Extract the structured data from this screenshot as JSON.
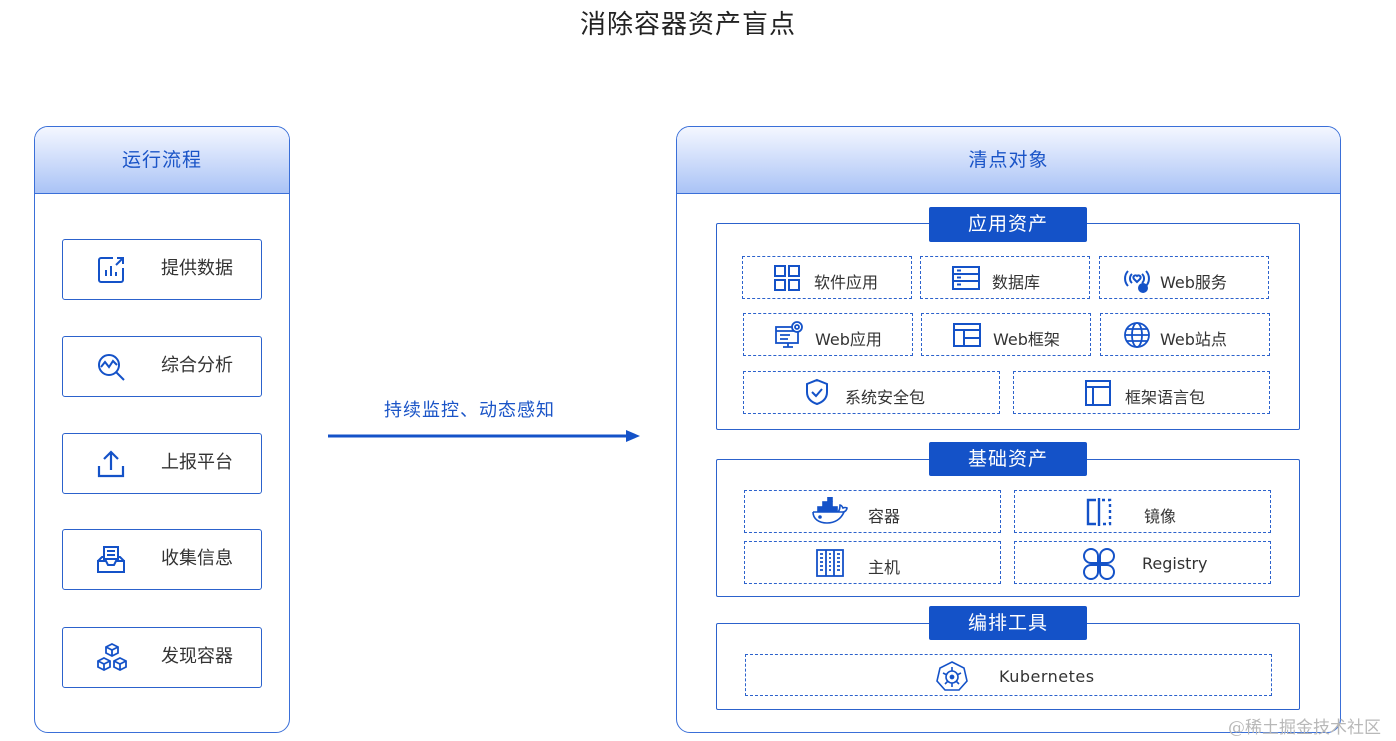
{
  "title": "消除容器资产盲点",
  "left_panel": {
    "header": "运行流程",
    "steps": [
      {
        "label": "提供数据",
        "icon": "bar-chart-icon"
      },
      {
        "label": "综合分析",
        "icon": "analysis-magnifier-icon"
      },
      {
        "label": "上报平台",
        "icon": "upload-icon"
      },
      {
        "label": "收集信息",
        "icon": "inbox-icon"
      },
      {
        "label": "发现容器",
        "icon": "cubes-icon"
      }
    ]
  },
  "arrow": {
    "label": "持续监控、动态感知"
  },
  "right_panel": {
    "header": "清点对象",
    "groups": [
      {
        "title": "应用资产",
        "items": [
          {
            "label": "软件应用",
            "icon": "grid-apps-icon"
          },
          {
            "label": "数据库",
            "icon": "database-icon"
          },
          {
            "label": "Web服务",
            "icon": "web-service-icon"
          },
          {
            "label": "Web应用",
            "icon": "web-app-icon"
          },
          {
            "label": "Web框架",
            "icon": "web-frame-icon"
          },
          {
            "label": "Web站点",
            "icon": "globe-icon"
          },
          {
            "label": "系统安全包",
            "icon": "shield-check-icon"
          },
          {
            "label": "框架语言包",
            "icon": "layout-icon"
          }
        ]
      },
      {
        "title": "基础资产",
        "items": [
          {
            "label": "容器",
            "icon": "docker-whale-icon"
          },
          {
            "label": "镜像",
            "icon": "mirror-image-icon"
          },
          {
            "label": "主机",
            "icon": "server-icon"
          },
          {
            "label": "Registry",
            "icon": "registry-icon"
          }
        ]
      },
      {
        "title": "编排工具",
        "items": [
          {
            "label": "Kubernetes",
            "icon": "kubernetes-icon"
          }
        ]
      }
    ]
  },
  "watermark": "@稀土掘金技术社区",
  "colors": {
    "primary": "#1452c8",
    "border": "#2c62cc",
    "header_gradient_end": "#aac3f6"
  }
}
